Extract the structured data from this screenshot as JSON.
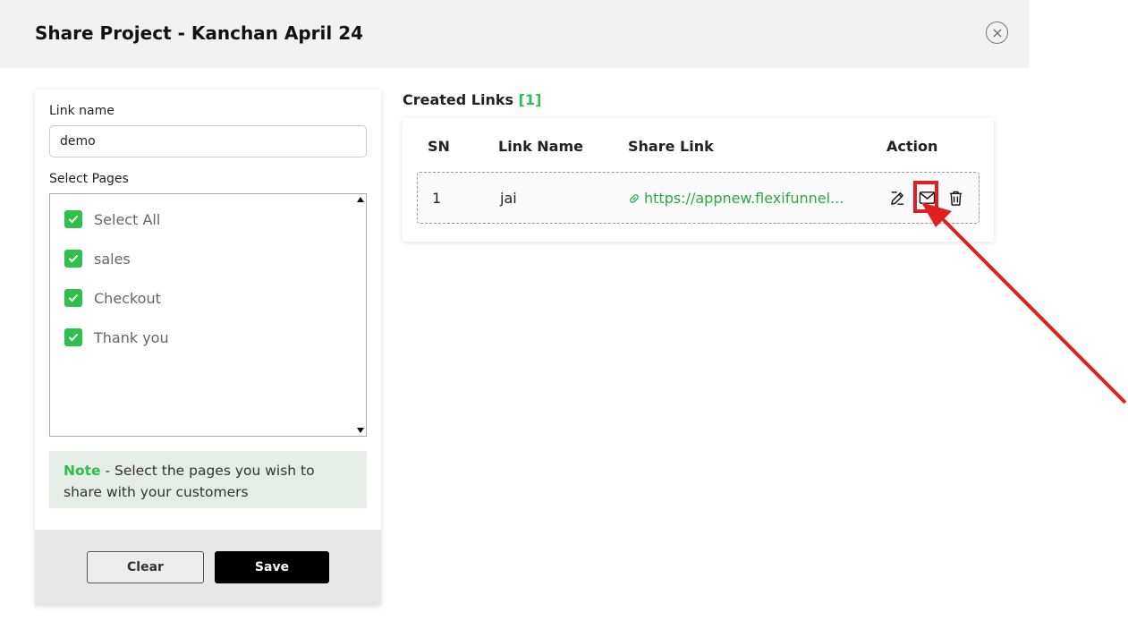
{
  "modal": {
    "title": "Share Project - Kanchan April 24",
    "close_icon": "close-circle-icon"
  },
  "form": {
    "link_name_label": "Link name",
    "link_name_value": "demo",
    "select_pages_label": "Select Pages",
    "pages": [
      {
        "label": "Select All",
        "checked": true
      },
      {
        "label": "sales",
        "checked": true
      },
      {
        "label": "Checkout",
        "checked": true
      },
      {
        "label": "Thank you",
        "checked": true
      }
    ],
    "note_strong": "Note",
    "note_text": " - Select the pages you wish to share with your customers",
    "clear_label": "Clear",
    "save_label": "Save"
  },
  "links": {
    "title": "Created Links",
    "count": "[1]",
    "headers": {
      "sn": "SN",
      "name": "Link Name",
      "share": "Share Link",
      "action": "Action"
    },
    "rows": [
      {
        "sn": "1",
        "name": "jai",
        "share": "https://appnew.flexifunnel...",
        "actions": [
          "edit-icon",
          "mail-icon",
          "trash-icon"
        ]
      }
    ]
  },
  "colors": {
    "accent_green": "#2ec04a",
    "annotation_red": "#e02020"
  }
}
